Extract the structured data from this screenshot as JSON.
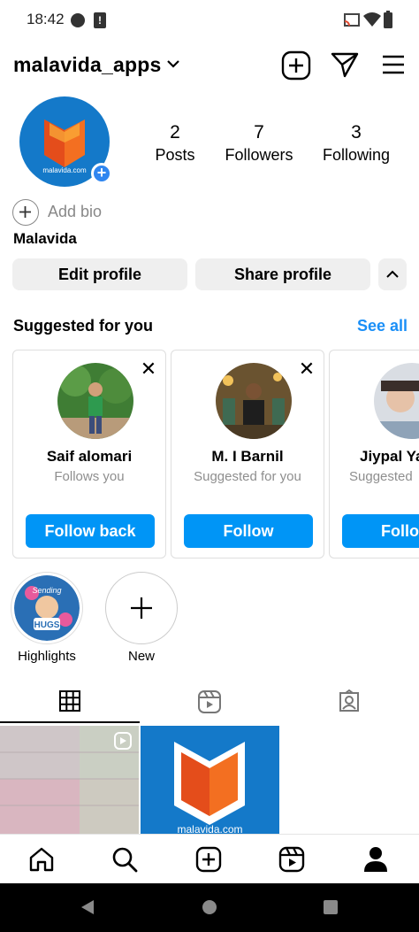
{
  "status": {
    "time": "18:42"
  },
  "profile": {
    "username": "malavida_apps",
    "avatar_caption": "malavida.com",
    "stats": [
      {
        "num": "2",
        "label": "Posts"
      },
      {
        "num": "7",
        "label": "Followers"
      },
      {
        "num": "3",
        "label": "Following"
      }
    ],
    "add_bio": "Add bio",
    "full_name": "Malavida",
    "edit_profile": "Edit profile",
    "share_profile": "Share profile"
  },
  "suggested": {
    "title": "Suggested for you",
    "see_all": "See all",
    "cards": [
      {
        "name": "Saif alomari",
        "sub": "Follows you",
        "button": "Follow back"
      },
      {
        "name": "M. I Barnil",
        "sub": "Suggested for you",
        "button": "Follow"
      },
      {
        "name": "Jiypal Ya",
        "sub": "Suggested",
        "button": "Follo"
      }
    ]
  },
  "highlights": {
    "items": [
      {
        "label": "Highlights",
        "sticker_top": "Sending",
        "sticker_bottom": "HUGS"
      },
      {
        "label": "New"
      }
    ]
  },
  "grid": {
    "tile2_caption": "malavida.com"
  },
  "colors": {
    "accent": "#0095f6",
    "brand_blue": "#1479c9",
    "brand_orange": "#f36f21"
  }
}
